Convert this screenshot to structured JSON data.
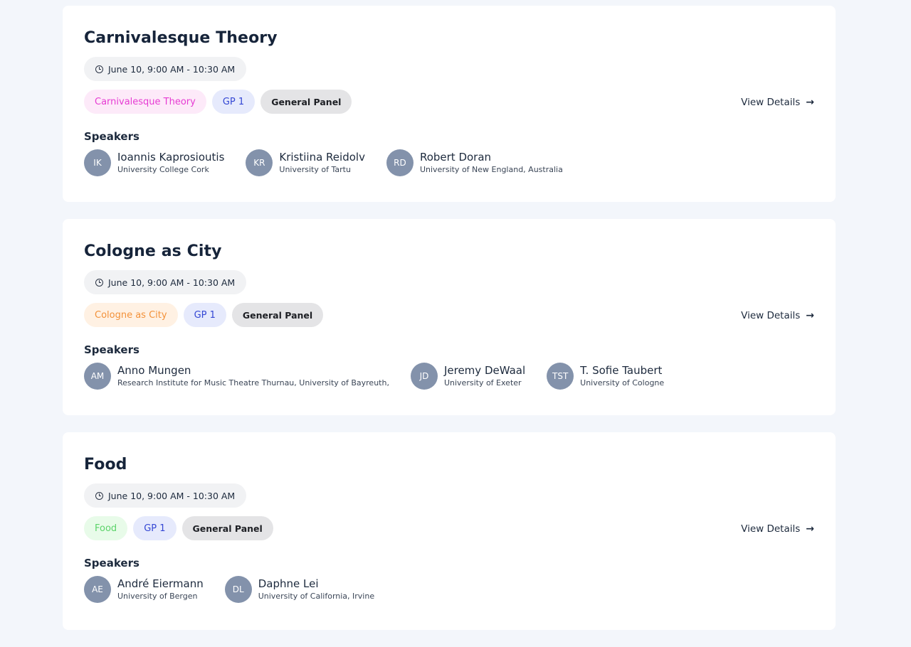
{
  "sessions": [
    {
      "title": "Carnivalesque Theory",
      "time": "June 10, 9:00 AM - 10:30 AM",
      "tags": [
        "Carnivalesque Theory",
        "GP 1",
        "General Panel"
      ],
      "tag_color": "#e63bd3",
      "view_details": "View Details",
      "speakers_label": "Speakers",
      "speakers": [
        {
          "initials": "IK",
          "name": "Ioannis Kaprosioutis",
          "affiliation": "University College Cork"
        },
        {
          "initials": "KR",
          "name": "Kristiina Reidolv",
          "affiliation": "University of Tartu"
        },
        {
          "initials": "RD",
          "name": "Robert Doran",
          "affiliation": "University of New England, Australia"
        }
      ]
    },
    {
      "title": "Cologne as City",
      "time": "June 10, 9:00 AM - 10:30 AM",
      "tags": [
        "Cologne as City",
        "GP 1",
        "General Panel"
      ],
      "tag_color": "#f3923a",
      "view_details": "View Details",
      "speakers_label": "Speakers",
      "speakers": [
        {
          "initials": "AM",
          "name": "Anno Mungen",
          "affiliation": "Research Institute for Music Theatre Thurnau, University of Bayreuth,"
        },
        {
          "initials": "JD",
          "name": "Jeremy DeWaal",
          "affiliation": "University of Exeter"
        },
        {
          "initials": "TST",
          "name": "T. Sofie Taubert",
          "affiliation": "University of Cologne"
        }
      ]
    },
    {
      "title": "Food",
      "time": "June 10, 9:00 AM - 10:30 AM",
      "tags": [
        "Food",
        "GP 1",
        "General Panel"
      ],
      "tag_color": "#5cd36a",
      "view_details": "View Details",
      "speakers_label": "Speakers",
      "speakers": [
        {
          "initials": "AE",
          "name": "André Eiermann",
          "affiliation": "University of Bergen"
        },
        {
          "initials": "DL",
          "name": "Daphne Lei",
          "affiliation": "University of California, Irvine"
        }
      ]
    }
  ]
}
